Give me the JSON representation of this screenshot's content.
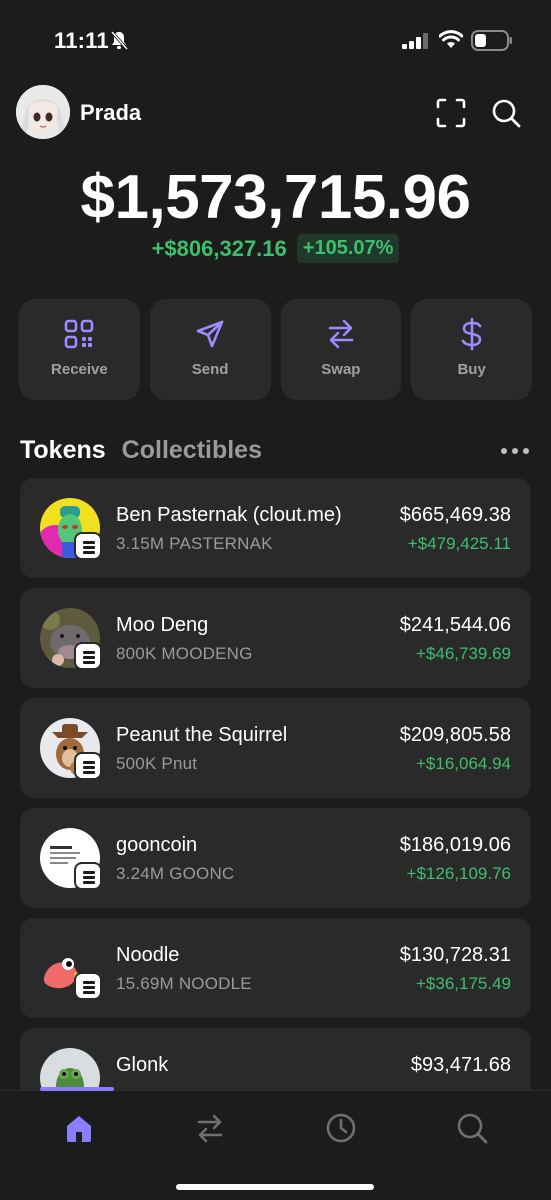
{
  "status_bar": {
    "time": "11:11",
    "icons": [
      "bell-off-icon",
      "signal-icon",
      "wifi-icon",
      "battery-icon"
    ]
  },
  "header": {
    "username": "Prada",
    "icons": [
      "scan-icon",
      "search-icon"
    ]
  },
  "portfolio": {
    "balance": "$1,573,715.96",
    "pnl_amount": "+$806,327.16",
    "pnl_percent": "+105.07%"
  },
  "actions": [
    {
      "label": "Receive",
      "icon": "qr-code-icon"
    },
    {
      "label": "Send",
      "icon": "send-icon"
    },
    {
      "label": "Swap",
      "icon": "swap-icon"
    },
    {
      "label": "Buy",
      "icon": "dollar-icon"
    }
  ],
  "tabs": {
    "tokens": "Tokens",
    "collectibles": "Collectibles"
  },
  "tokens": [
    {
      "name": "Ben Pasternak (clout.me)",
      "amount": "3.15M PASTERNAK",
      "value": "$665,469.38",
      "change": "+$479,425.11"
    },
    {
      "name": "Moo Deng",
      "amount": "800K MOODENG",
      "value": "$241,544.06",
      "change": "+$46,739.69"
    },
    {
      "name": "Peanut the Squirrel",
      "amount": "500K Pnut",
      "value": "$209,805.58",
      "change": "+$16,064.94"
    },
    {
      "name": "gooncoin",
      "amount": "3.24M GOONC",
      "value": "$186,019.06",
      "change": "+$126,109.76"
    },
    {
      "name": "Noodle",
      "amount": "15.69M NOODLE",
      "value": "$130,728.31",
      "change": "+$36,175.49"
    },
    {
      "name": "Glonk",
      "amount": "",
      "value": "$93,471.68",
      "change": ""
    }
  ],
  "bottom_nav": [
    "home-icon",
    "swap-nav-icon",
    "history-icon",
    "search-nav-icon"
  ],
  "colors": {
    "background": "#1c1c1c",
    "card": "#2a2a2a",
    "accent": "#8c7dff",
    "positive": "#3dbf6e"
  }
}
